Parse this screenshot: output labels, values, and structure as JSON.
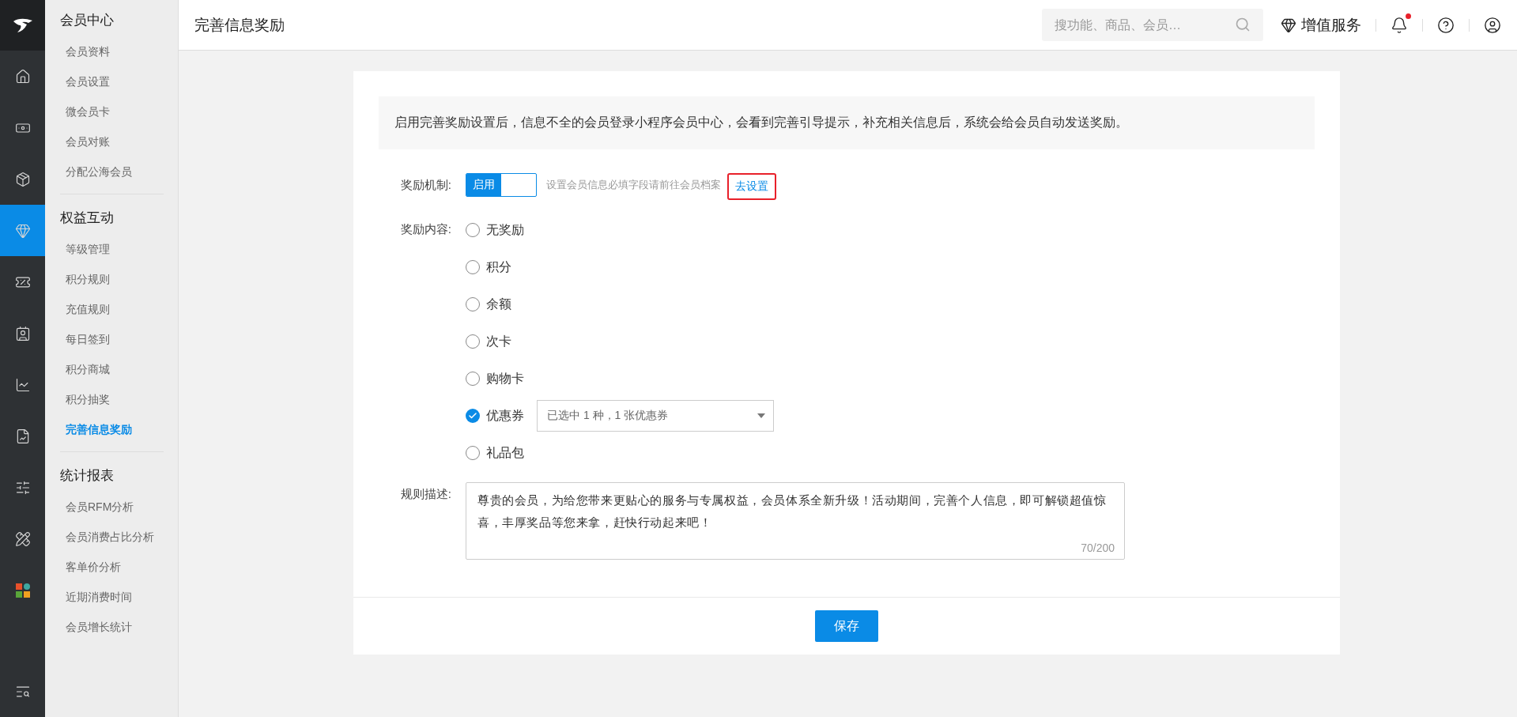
{
  "rail": {
    "items": [
      {
        "kind": "home",
        "selected": false
      },
      {
        "kind": "money",
        "selected": false
      },
      {
        "kind": "box",
        "selected": false
      },
      {
        "kind": "gem",
        "selected": true
      },
      {
        "kind": "ticket",
        "selected": false
      },
      {
        "kind": "card",
        "selected": false
      },
      {
        "kind": "chart",
        "selected": false
      },
      {
        "kind": "report",
        "selected": false
      },
      {
        "kind": "sliders",
        "selected": false
      },
      {
        "kind": "tools",
        "selected": false
      },
      {
        "kind": "apps",
        "selected": false
      }
    ]
  },
  "sidebar": {
    "groups": [
      {
        "title": "会员中心",
        "items": [
          {
            "label": "会员资料",
            "selected": false
          },
          {
            "label": "会员设置",
            "selected": false
          },
          {
            "label": "微会员卡",
            "selected": false
          },
          {
            "label": "会员对账",
            "selected": false
          },
          {
            "label": "分配公海会员",
            "selected": false
          }
        ]
      },
      {
        "title": "权益互动",
        "items": [
          {
            "label": "等级管理",
            "selected": false
          },
          {
            "label": "积分规则",
            "selected": false
          },
          {
            "label": "充值规则",
            "selected": false
          },
          {
            "label": "每日签到",
            "selected": false
          },
          {
            "label": "积分商城",
            "selected": false
          },
          {
            "label": "积分抽奖",
            "selected": false
          },
          {
            "label": "完善信息奖励",
            "selected": true
          }
        ]
      },
      {
        "title": "统计报表",
        "items": [
          {
            "label": "会员RFM分析",
            "selected": false
          },
          {
            "label": "会员消费占比分析",
            "selected": false
          },
          {
            "label": "客单价分析",
            "selected": false
          },
          {
            "label": "近期消费时间",
            "selected": false
          },
          {
            "label": "会员增长统计",
            "selected": false
          }
        ]
      }
    ]
  },
  "header": {
    "title": "完善信息奖励",
    "search": {
      "placeholder": "搜功能、商品、会员…"
    },
    "value_service": "增值服务",
    "notifications": {
      "unread": true
    }
  },
  "notice": "启用完善奖励设置后，信息不全的会员登录小程序会员中心，会看到完善引导提示，补充相关信息后，系统会给会员自动发送奖励。",
  "mechanism": {
    "label": "奖励机制:",
    "toggle": {
      "label": "启用",
      "on": true
    },
    "hint": "设置会员信息必填字段请前往会员档案",
    "link": "去设置"
  },
  "content": {
    "label": "奖励内容:",
    "options": [
      {
        "label": "无奖励",
        "selected": false
      },
      {
        "label": "积分",
        "selected": false
      },
      {
        "label": "余额",
        "selected": false
      },
      {
        "label": "次卡",
        "selected": false
      },
      {
        "label": "购物卡",
        "selected": false
      },
      {
        "label": "优惠券",
        "selected": true,
        "dropdown_value": "已选中 1 种，1 张优惠券"
      },
      {
        "label": "礼品包",
        "selected": false
      }
    ]
  },
  "description": {
    "label": "规则描述:",
    "value": "尊贵的会员，为给您带来更贴心的服务与专属权益，会员体系全新升级！活动期间，完善个人信息，即可解锁超值惊喜，丰厚奖品等您来拿，赶快行动起来吧！",
    "counter": "70/200"
  },
  "save_button": "保存"
}
